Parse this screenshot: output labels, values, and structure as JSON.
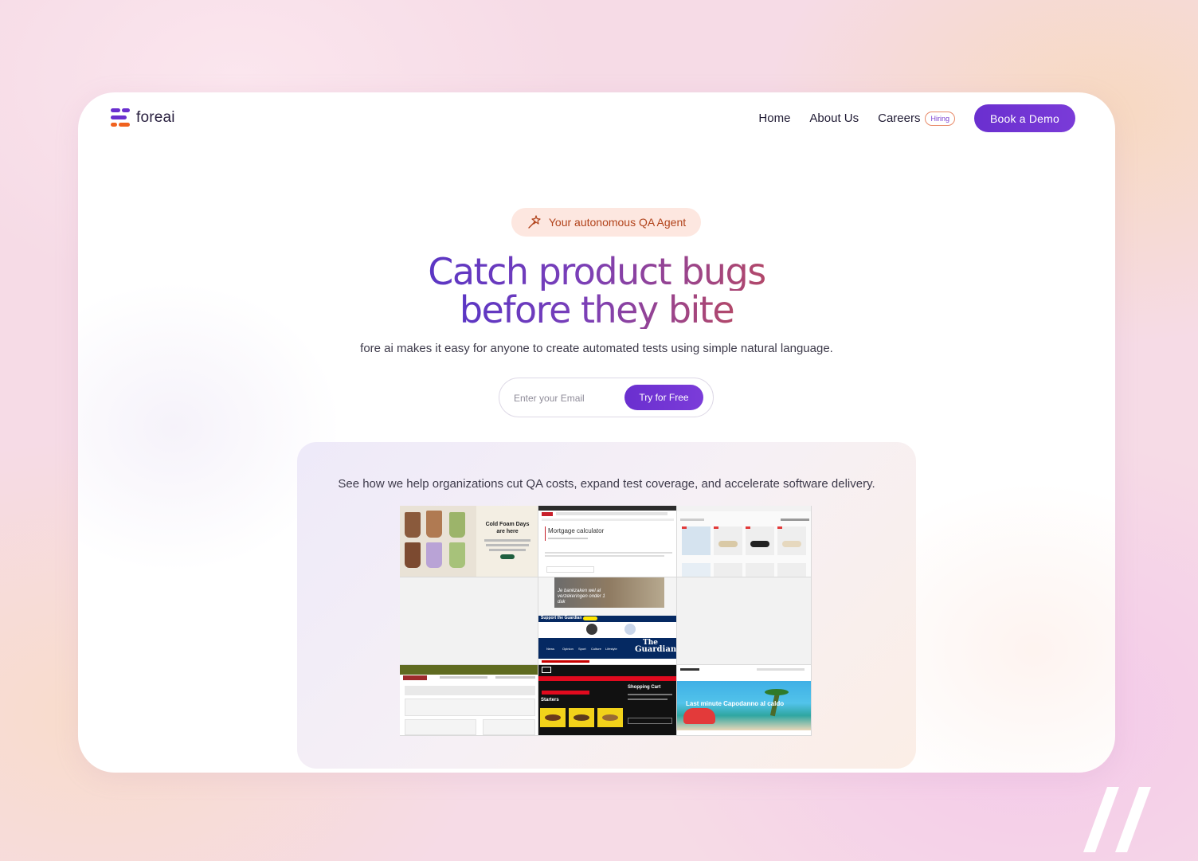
{
  "nav": {
    "logo_text": "foreai",
    "links": [
      "Home",
      "About Us",
      "Careers"
    ],
    "hiring_badge": "Hiring",
    "demo_button": "Book a Demo"
  },
  "hero": {
    "pill_text": "Your autonomous QA Agent",
    "headline_line1": "Catch product bugs",
    "headline_line2": "before they bite",
    "subtitle": "fore ai makes it easy for anyone to create automated tests using simple natural language.",
    "email_placeholder": "Enter your Email",
    "cta_button": "Try for Free"
  },
  "showcase": {
    "caption": "See how we help organizations cut QA costs, expand test coverage, and accelerate software delivery.",
    "tiles": {
      "coffee_title": "Cold Foam Days",
      "coffee_subtitle": "are here",
      "mortgage_title": "Mortgage calculator",
      "bank_text": "Je bankzaken wel al verzekeringen onder 1 dak",
      "guardian_support": "Support the Guardian",
      "guardian_logo_line1": "The",
      "guardian_logo_line2": "Guardian",
      "guardian_nav": [
        "News",
        "Opinion",
        "Sport",
        "Culture",
        "Lifestyle"
      ],
      "cart_title": "Shopping Cart",
      "food_section": "Starters",
      "travel_text": "Last minute Capodanno al caldo"
    }
  },
  "colors": {
    "accent": "#6a2fcf",
    "headline_start": "#5b36c4",
    "headline_end": "#b2486a",
    "pill_bg": "#fde7e0"
  }
}
